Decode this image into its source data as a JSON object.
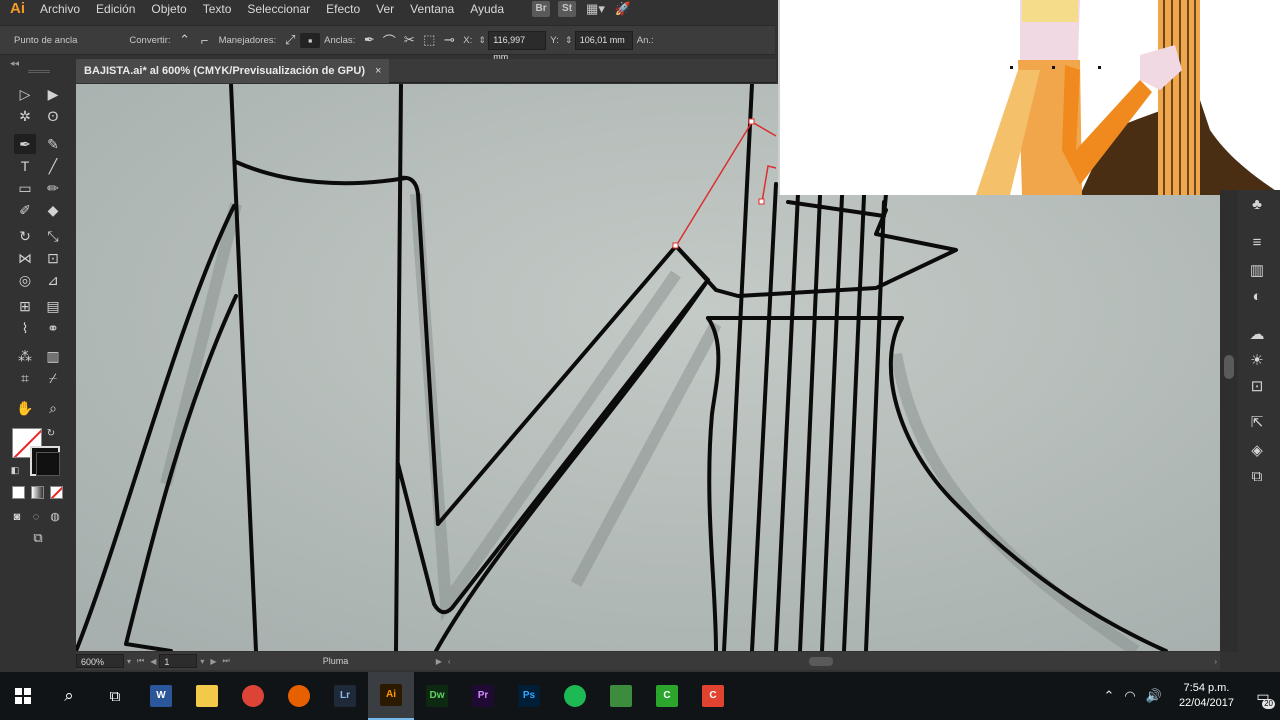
{
  "app": {
    "logo": "Ai",
    "accent": "#f59a23"
  },
  "menu": {
    "items": [
      "Archivo",
      "Edición",
      "Objeto",
      "Texto",
      "Seleccionar",
      "Efecto",
      "Ver",
      "Ventana",
      "Ayuda"
    ],
    "badges": [
      "Br",
      "St"
    ]
  },
  "controlbar": {
    "anchor_label": "Punto de ancla",
    "convert_label": "Convertir:",
    "handles_label": "Manejadores:",
    "anchors_label": "Anclas:",
    "x_label": "X:",
    "x_value": "116,997 mm",
    "y_label": "Y:",
    "y_value": "106,01 mm",
    "width_label": "An.:"
  },
  "document_tab": {
    "title": "BAJISTA.ai* al 600% (CMYK/Previsualización de GPU)",
    "close": "×"
  },
  "tools": {
    "collapse": "◂◂",
    "items": [
      {
        "name": "selection-tool",
        "glyph": "▷"
      },
      {
        "name": "direct-selection-tool",
        "glyph": "▶"
      },
      {
        "name": "magic-wand-tool",
        "glyph": "✲"
      },
      {
        "name": "lasso-tool",
        "glyph": "ʘ"
      },
      {
        "name": "pen-tool",
        "glyph": "✒"
      },
      {
        "name": "curvature-tool",
        "glyph": "✎"
      },
      {
        "name": "type-tool",
        "glyph": "T"
      },
      {
        "name": "line-tool",
        "glyph": "╱"
      },
      {
        "name": "rectangle-tool",
        "glyph": "▭"
      },
      {
        "name": "paintbrush-tool",
        "glyph": "✏"
      },
      {
        "name": "shaper-tool",
        "glyph": "✐"
      },
      {
        "name": "eraser-tool",
        "glyph": "◆"
      },
      {
        "name": "rotate-tool",
        "glyph": "↻"
      },
      {
        "name": "scale-tool",
        "glyph": "⤡"
      },
      {
        "name": "width-tool",
        "glyph": "⋈"
      },
      {
        "name": "free-transform-tool",
        "glyph": "⊡"
      },
      {
        "name": "shape-builder-tool",
        "glyph": "◎"
      },
      {
        "name": "perspective-grid-tool",
        "glyph": "⊿"
      },
      {
        "name": "mesh-tool",
        "glyph": "⊞"
      },
      {
        "name": "gradient-tool",
        "glyph": "▤"
      },
      {
        "name": "eyedropper-tool",
        "glyph": "⌇"
      },
      {
        "name": "blend-tool",
        "glyph": "⚭"
      },
      {
        "name": "symbol-sprayer-tool",
        "glyph": "⁂"
      },
      {
        "name": "column-graph-tool",
        "glyph": "▥"
      },
      {
        "name": "artboard-tool",
        "glyph": "⌗"
      },
      {
        "name": "slice-tool",
        "glyph": "⌿"
      },
      {
        "name": "hand-tool",
        "glyph": "✋"
      },
      {
        "name": "zoom-tool",
        "glyph": "⌕"
      }
    ]
  },
  "statusbar": {
    "zoom": "600%",
    "artboard": "1",
    "current_tool": "Pluma"
  },
  "taskbar": {
    "apps": [
      {
        "name": "word",
        "label": "W",
        "bg": "#2b579a",
        "fg": "#ffffff"
      },
      {
        "name": "file-explorer",
        "label": "",
        "bg": "#f3c94a",
        "fg": "#000000"
      },
      {
        "name": "chrome",
        "label": "",
        "bg": "#db4437",
        "fg": "#ffffff"
      },
      {
        "name": "firefox",
        "label": "",
        "bg": "#e66000",
        "fg": "#ffffff"
      },
      {
        "name": "lightroom",
        "label": "Lr",
        "bg": "#1e2a3a",
        "fg": "#8fb8e8"
      },
      {
        "name": "illustrator",
        "label": "Ai",
        "bg": "#2c1a00",
        "fg": "#ff9a00"
      },
      {
        "name": "dreamweaver",
        "label": "Dw",
        "bg": "#0d2a10",
        "fg": "#5fd068"
      },
      {
        "name": "premiere",
        "label": "Pr",
        "bg": "#1f0a33",
        "fg": "#d58cff"
      },
      {
        "name": "photoshop",
        "label": "Ps",
        "bg": "#001e36",
        "fg": "#31a8ff"
      },
      {
        "name": "spotify",
        "label": "",
        "bg": "#1db954",
        "fg": "#000000"
      },
      {
        "name": "inkscape-like",
        "label": "",
        "bg": "#3d8c3d",
        "fg": "#ffffff"
      },
      {
        "name": "camtasia-green",
        "label": "C",
        "bg": "#2ba52b",
        "fg": "#ffffff"
      },
      {
        "name": "camtasia-red",
        "label": "C",
        "bg": "#e04431",
        "fg": "#ffffff"
      }
    ],
    "time": "7:54 p.m.",
    "date": "22/04/2017",
    "notifications": "20"
  }
}
